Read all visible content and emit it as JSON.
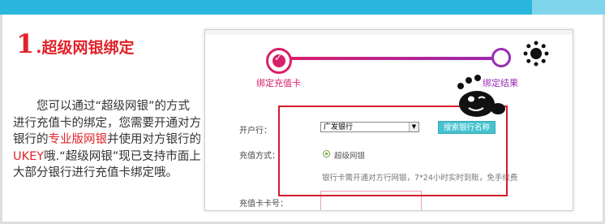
{
  "section": {
    "number": "1",
    "title": ".超级网银绑定"
  },
  "description": {
    "part1": "您可以通过“超级网银”的方式进行充值卡的绑定，您需要开通对方银行的",
    "highlight1": "专业版网银",
    "part2": "并使用对方银行的",
    "highlight2": "UKEY",
    "part3": "哦.“超级网银”现已支持市面上大部分银行进行充值卡绑定哦。"
  },
  "steps": [
    {
      "label": "绑定充值卡",
      "state": "completed",
      "icon": "check-icon"
    },
    {
      "label": "绑定结果",
      "state": "pending"
    }
  ],
  "form": {
    "bank_label": "开户行：",
    "bank_selected": "广发银行",
    "search_button": "搜索银行名称",
    "method_label": "充值方式：",
    "method_option": "超级网银",
    "note": "银行卡需开通对方行网银，7*24小时实时到账，免手续费",
    "card_label": "充值卡卡号："
  },
  "colors": {
    "accent_red": "#e0232a",
    "step_pink": "#d8206a",
    "step_purple": "#9a2bb5",
    "button_teal": "#45c2cf",
    "top_bar": "#2bb7dd"
  },
  "decorations": [
    "sun-icon",
    "mascot-blob"
  ]
}
